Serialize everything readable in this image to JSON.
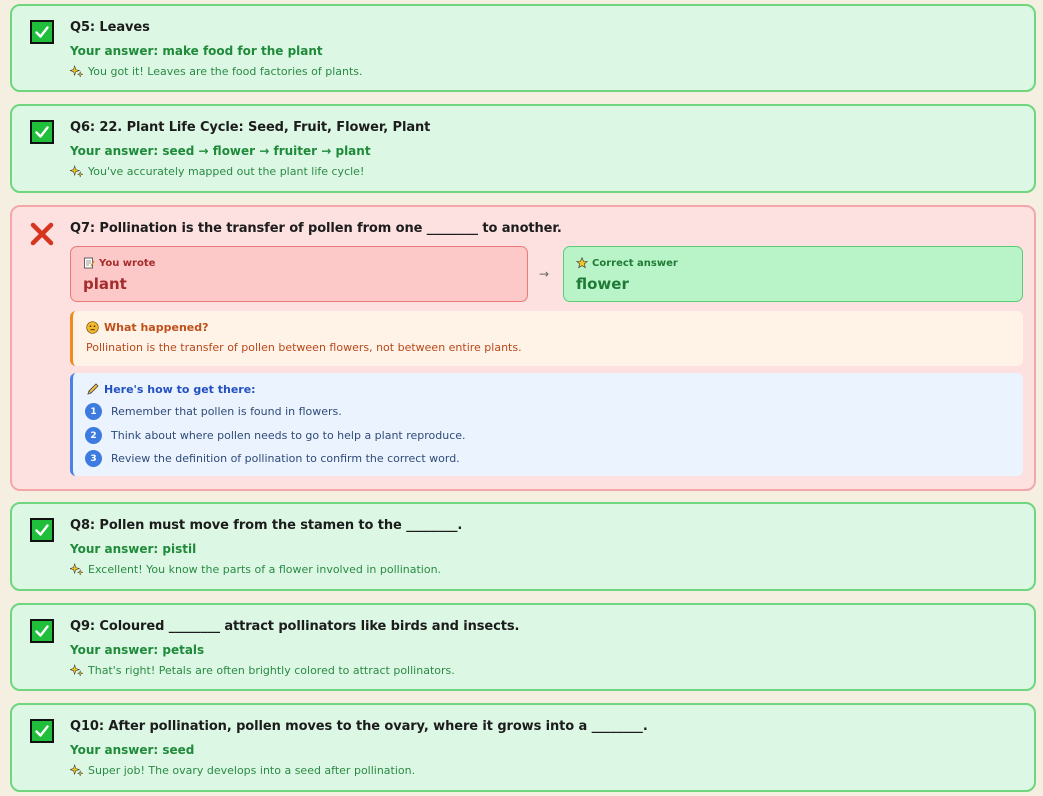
{
  "questions": [
    {
      "title": "Q5: Leaves",
      "answer": "Your answer: make food for the plant",
      "feedback": "You got it! Leaves are the food factories of plants."
    },
    {
      "title": "Q6: 22. Plant Life Cycle: Seed, Fruit, Flower, Plant",
      "answer": "Your answer: seed → flower → fruiter → plant",
      "feedback": "You've accurately mapped out the plant life cycle!"
    },
    {
      "title": "Q7: Pollination is the transfer of pollen from one ________ to another.",
      "you_wrote_label": "You wrote",
      "you_wrote_value": "plant",
      "arrow": "→",
      "correct_label": "Correct answer",
      "correct_value": "flower",
      "what_happened_title": "What happened?",
      "what_happened_text": "Pollination is the transfer of pollen between flowers, not between entire plants.",
      "howto_title": "Here's how to get there:",
      "steps": [
        {
          "num": "1",
          "text": "Remember that pollen is found in flowers."
        },
        {
          "num": "2",
          "text": "Think about where pollen needs to go to help a plant reproduce."
        },
        {
          "num": "3",
          "text": "Review the definition of pollination to confirm the correct word."
        }
      ]
    },
    {
      "title": "Q8: Pollen must move from the stamen to the ________.",
      "answer": "Your answer: pistil",
      "feedback": "Excellent! You know the parts of a flower involved in pollination."
    },
    {
      "title": "Q9: Coloured ________ attract pollinators like birds and insects.",
      "answer": "Your answer: petals",
      "feedback": "That's right! Petals are often brightly colored to attract pollinators."
    },
    {
      "title": "Q10: After pollination, pollen moves to the ovary, where it grows into a ________.",
      "answer": "Your answer: seed",
      "feedback": "Super job! The ovary develops into a seed after pollination."
    }
  ],
  "icons": {
    "correct": "check-icon",
    "incorrect": "x-icon",
    "feedback": "sparkle-icon"
  },
  "colors": {
    "correct_bg": "#dcf8e4",
    "correct_border": "#6fd67f",
    "wrong_bg": "#fde0e0",
    "wrong_border": "#f2a8a8"
  }
}
